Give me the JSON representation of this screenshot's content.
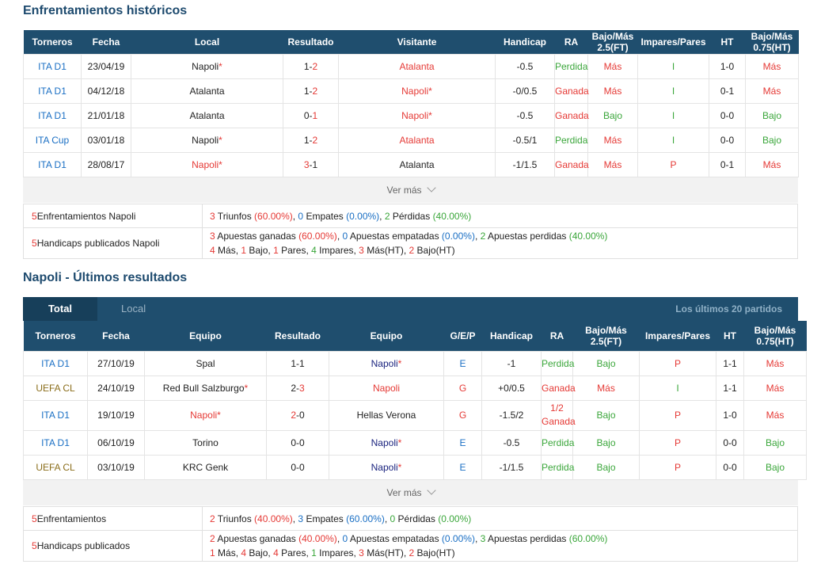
{
  "h2h": {
    "title": "Enfrentamientos históricos",
    "headers": [
      "Torneros",
      "Fecha",
      "Local",
      "Resultado",
      "Visitante",
      "Handicap",
      "RA",
      "Bajo/Más 2.5(FT)",
      "Impares/Pares",
      "HT",
      "Bajo/Más 0.75(HT)"
    ],
    "rows": [
      {
        "torneo": "ITA D1",
        "fecha": "23/04/19",
        "local": "Napoli",
        "local_star": "*",
        "res_a": "1",
        "res_sep": "-",
        "res_b": "2",
        "visitante": "Atalanta",
        "visit_star": "",
        "handicap": "-0.5",
        "ra": "Perdida",
        "bm": "Más",
        "ip": "I",
        "ht": "1-0",
        "bm_ht": "Más"
      },
      {
        "torneo": "ITA D1",
        "fecha": "04/12/18",
        "local": "Atalanta",
        "local_star": "",
        "res_a": "1",
        "res_sep": "-",
        "res_b": "2",
        "visitante": "Napoli",
        "visit_star": "*",
        "handicap": "-0/0.5",
        "ra": "Ganada",
        "bm": "Más",
        "ip": "I",
        "ht": "0-1",
        "bm_ht": "Más"
      },
      {
        "torneo": "ITA D1",
        "fecha": "21/01/18",
        "local": "Atalanta",
        "local_star": "",
        "res_a": "0",
        "res_sep": "-",
        "res_b": "1",
        "visitante": "Napoli",
        "visit_star": "*",
        "handicap": "-0.5",
        "ra": "Ganada",
        "bm": "Bajo",
        "ip": "I",
        "ht": "0-0",
        "bm_ht": "Bajo"
      },
      {
        "torneo": "ITA Cup",
        "fecha": "03/01/18",
        "local": "Napoli",
        "local_star": "*",
        "res_a": "1",
        "res_sep": "-",
        "res_b": "2",
        "visitante": "Atalanta",
        "visit_star": "",
        "handicap": "-0.5/1",
        "ra": "Perdida",
        "bm": "Más",
        "ip": "I",
        "ht": "0-0",
        "bm_ht": "Bajo"
      },
      {
        "torneo": "ITA D1",
        "fecha": "28/08/17",
        "local": "Napoli",
        "local_star": "*",
        "res_a": "3",
        "res_sep": "-",
        "res_b": "1",
        "visitante": "Atalanta",
        "visit_star": "",
        "handicap": "-1/1.5",
        "ra": "Ganada",
        "bm": "Más",
        "ip": "P",
        "ht": "0-1",
        "bm_ht": "Más"
      }
    ],
    "ver_mas": "Ver más",
    "summary": {
      "row1_label_n": "5",
      "row1_label": " Enfrentamientos Napoli",
      "row1": {
        "w": "3",
        "w_t": " Triunfos ",
        "w_p": "(60.00%)",
        "d": "0",
        "d_t": " Empates ",
        "d_p": "(0.00%)",
        "l": "2",
        "l_t": " Pérdidas ",
        "l_p": "(40.00%)"
      },
      "row2_label_n": "5",
      "row2_label": " Handicaps publicados Napoli",
      "row2a": {
        "w": "3",
        "w_t": " Apuestas ganadas ",
        "w_p": "(60.00%)",
        "d": "0",
        "d_t": " Apuestas empatadas ",
        "d_p": "(0.00%)",
        "l": "2",
        "l_t": " Apuestas perdidas ",
        "l_p": "(40.00%)"
      },
      "row2b": {
        "a": "4",
        "a_t": " Más, ",
        "b": "1",
        "b_t": " Bajo, ",
        "c": "1",
        "c_t": " Pares, ",
        "d": "4",
        "d_t": " Impares, ",
        "e": "3",
        "e_t": " Más(HT), ",
        "f": "2",
        "f_t": " Bajo(HT)"
      }
    }
  },
  "recent": {
    "title": "Napoli - Últimos resultados",
    "tab_total": "Total",
    "tab_local": "Local",
    "tab_right": "Los últimos 20 partidos",
    "headers": [
      "Torneros",
      "Fecha",
      "Equipo",
      "Resultado",
      "Equipo",
      "G/E/P",
      "Handicap",
      "RA",
      "Bajo/Más 2.5(FT)",
      "Impares/Pares",
      "HT",
      "Bajo/Más 0.75(HT)"
    ],
    "rows": [
      {
        "torneo": "ITA D1",
        "torneo_color": "#1a6fc4",
        "fecha": "27/10/19",
        "eq1": "Spal",
        "eq1_star": "",
        "eq1_color": "#222222",
        "res_a": "1",
        "res_b": "1",
        "res_b_color": "#222222",
        "eq2": "Napoli",
        "eq2_star": "*",
        "eq2_color": "#1a237e",
        "gep": "E",
        "gep_color": "#1a6fc4",
        "handicap": "-1",
        "ra": "Perdida",
        "ra_color": "#3aa63a",
        "bm": "Bajo",
        "bm_color": "#3aa63a",
        "ip": "P",
        "ip_color": "#e53935",
        "ht": "1-1",
        "bm_ht": "Más",
        "bm_ht_color": "#e53935"
      },
      {
        "torneo": "UEFA CL",
        "torneo_color": "#8a6d1a",
        "fecha": "24/10/19",
        "eq1": "Red Bull Salzburgo",
        "eq1_star": "*",
        "eq1_color": "#222222",
        "res_a": "2",
        "res_b": "3",
        "res_b_color": "#e53935",
        "eq2": "Napoli",
        "eq2_star": "",
        "eq2_color": "#e53935",
        "gep": "G",
        "gep_color": "#e53935",
        "handicap": "+0/0.5",
        "ra": "Ganada",
        "ra_color": "#e53935",
        "bm": "Más",
        "bm_color": "#e53935",
        "ip": "I",
        "ip_color": "#3aa63a",
        "ht": "1-1",
        "bm_ht": "Más",
        "bm_ht_color": "#e53935"
      },
      {
        "torneo": "ITA D1",
        "torneo_color": "#1a6fc4",
        "fecha": "19/10/19",
        "eq1": "Napoli",
        "eq1_star": "*",
        "eq1_color": "#e53935",
        "res_a": "2",
        "res_a_color": "#e53935",
        "res_b": "0",
        "res_b_color": "#222222",
        "eq2": "Hellas Verona",
        "eq2_star": "",
        "eq2_color": "#222222",
        "gep": "G",
        "gep_color": "#e53935",
        "handicap": "-1.5/2",
        "ra": "1/2 Ganada",
        "ra_line1": "1/2",
        "ra_line2": "Ganada",
        "ra_color": "#e53935",
        "bm": "Bajo",
        "bm_color": "#3aa63a",
        "ip": "P",
        "ip_color": "#e53935",
        "ht": "1-0",
        "bm_ht": "Más",
        "bm_ht_color": "#e53935"
      },
      {
        "torneo": "ITA D1",
        "torneo_color": "#1a6fc4",
        "fecha": "06/10/19",
        "eq1": "Torino",
        "eq1_star": "",
        "eq1_color": "#222222",
        "res_a": "0",
        "res_b": "0",
        "res_b_color": "#222222",
        "eq2": "Napoli",
        "eq2_star": "*",
        "eq2_color": "#1a237e",
        "gep": "E",
        "gep_color": "#1a6fc4",
        "handicap": "-0.5",
        "ra": "Perdida",
        "ra_color": "#3aa63a",
        "bm": "Bajo",
        "bm_color": "#3aa63a",
        "ip": "P",
        "ip_color": "#e53935",
        "ht": "0-0",
        "bm_ht": "Bajo",
        "bm_ht_color": "#3aa63a"
      },
      {
        "torneo": "UEFA CL",
        "torneo_color": "#8a6d1a",
        "fecha": "03/10/19",
        "eq1": "KRC Genk",
        "eq1_star": "",
        "eq1_color": "#222222",
        "res_a": "0",
        "res_b": "0",
        "res_b_color": "#222222",
        "eq2": "Napoli",
        "eq2_star": "*",
        "eq2_color": "#1a237e",
        "gep": "E",
        "gep_color": "#1a6fc4",
        "handicap": "-1/1.5",
        "ra": "Perdida",
        "ra_color": "#3aa63a",
        "bm": "Bajo",
        "bm_color": "#3aa63a",
        "ip": "P",
        "ip_color": "#e53935",
        "ht": "0-0",
        "bm_ht": "Bajo",
        "bm_ht_color": "#3aa63a"
      }
    ],
    "ver_mas": "Ver más",
    "summary": {
      "row1_label_n": "5",
      "row1_label": " Enfrentamientos",
      "row1": {
        "w": "2",
        "w_t": " Triunfos ",
        "w_p": "(40.00%)",
        "d": "3",
        "d_t": " Empates ",
        "d_p": "(60.00%)",
        "l": "0",
        "l_t": " Pérdidas ",
        "l_p": "(0.00%)"
      },
      "row2_label_n": "5",
      "row2_label": " Handicaps publicados",
      "row2a": {
        "w": "2",
        "w_t": " Apuestas ganadas ",
        "w_p": "(40.00%)",
        "d": "0",
        "d_t": " Apuestas empatadas ",
        "d_p": "(0.00%)",
        "l": "3",
        "l_t": " Apuestas perdidas ",
        "l_p": "(60.00%)"
      },
      "row2b": {
        "a": "1",
        "a_t": " Más, ",
        "b": "4",
        "b_t": " Bajo, ",
        "c": "4",
        "c_t": " Pares, ",
        "d": "1",
        "d_t": " Impares, ",
        "e": "3",
        "e_t": " Más(HT), ",
        "f": "2",
        "f_t": " Bajo(HT)"
      }
    }
  }
}
